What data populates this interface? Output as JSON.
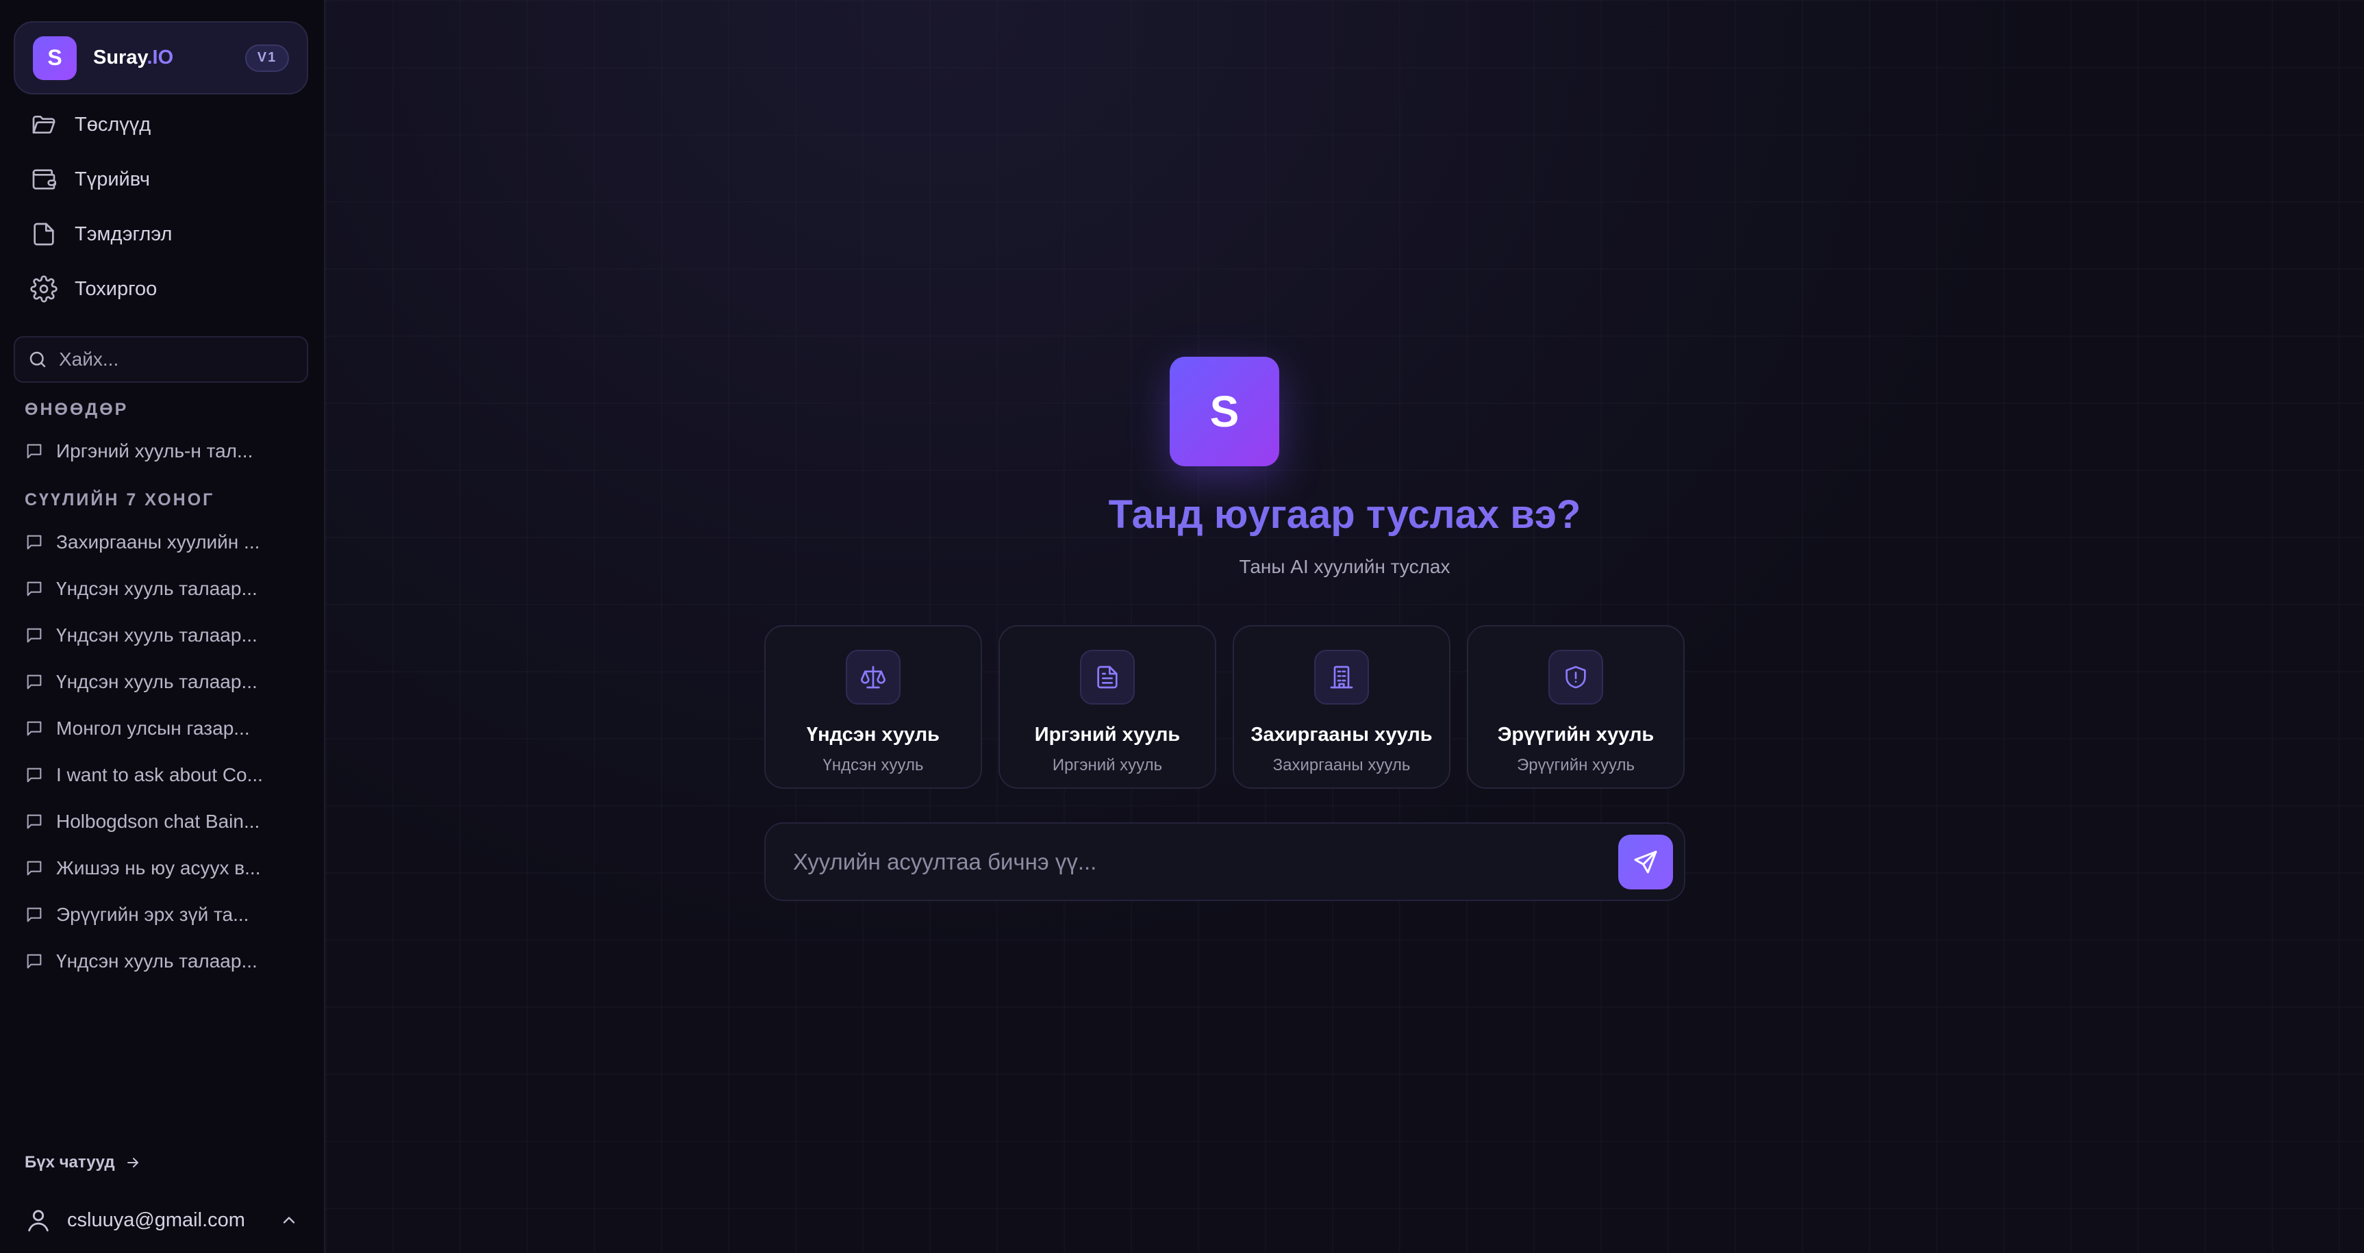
{
  "brand": {
    "logo_letter": "S",
    "name": "Suray",
    "name_accent": ".IO",
    "version": "V1"
  },
  "nav": [
    {
      "label": "Төслүүд",
      "icon": "folder-icon"
    },
    {
      "label": "Түрийвч",
      "icon": "wallet-icon"
    },
    {
      "label": "Тэмдэглэл",
      "icon": "file-icon"
    },
    {
      "label": "Тохиргоо",
      "icon": "gear-icon"
    }
  ],
  "search": {
    "placeholder": "Хайх..."
  },
  "sections": {
    "today": "Өнөөдөр",
    "last7": "Сүүлийн 7 хоног"
  },
  "chats_today": [
    "Иргэний хууль-н тал..."
  ],
  "chats_last7": [
    "Захиргааны хуулийн ...",
    "Үндсэн хууль талаар...",
    "Үндсэн хууль талаар...",
    "Үндсэн хууль талаар...",
    "Монгол улсын газар...",
    "I want to ask about Co...",
    "Holbogdson chat Bain...",
    "Жишээ нь юу асуух в...",
    "Эрүүгийн эрх зүй та...",
    "Үндсэн хууль талаар..."
  ],
  "footer": {
    "all_chats": "Бүх чатууд",
    "user_email": "csluuya@gmail.com"
  },
  "hero": {
    "logo_letter": "S",
    "title": "Танд юугаар туслах вэ?",
    "subtitle": "Таны AI хуулийн туслах"
  },
  "cards": [
    {
      "title": "Үндсэн хууль",
      "subtitle": "Үндсэн хууль",
      "icon": "scale-icon"
    },
    {
      "title": "Иргэний хууль",
      "subtitle": "Иргэний хууль",
      "icon": "document-icon"
    },
    {
      "title": "Захиргааны хууль",
      "subtitle": "Захиргааны хууль",
      "icon": "building-icon"
    },
    {
      "title": "Эрүүгийн хууль",
      "subtitle": "Эрүүгийн хууль",
      "icon": "shield-alert-icon"
    }
  ],
  "input": {
    "placeholder": "Хуулийн асуултаа бичнэ үү..."
  },
  "colors": {
    "accent": "#7b6cf0",
    "background": "#0e0d18",
    "sidebar": "#0b0a12"
  }
}
